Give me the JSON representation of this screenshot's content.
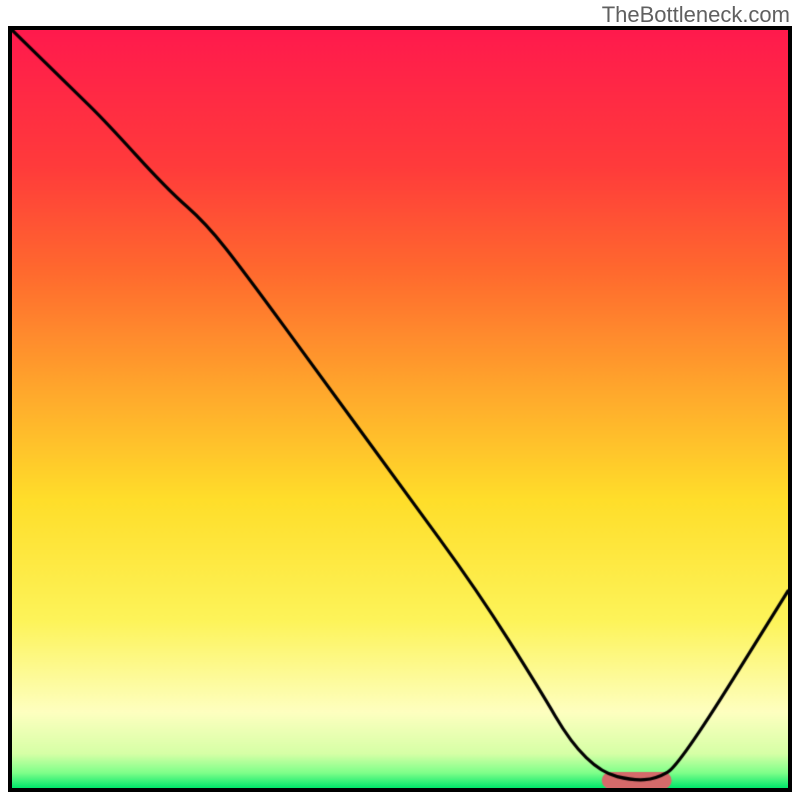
{
  "watermark": "TheBottleneck.com",
  "chart_data": {
    "type": "line",
    "title": "",
    "xlabel": "",
    "ylabel": "",
    "xlim": [
      0,
      100
    ],
    "ylim": [
      0,
      100
    ],
    "grid": false,
    "legend": false,
    "background_gradient": [
      {
        "t": 0.0,
        "color": "#ff1a4d"
      },
      {
        "t": 0.18,
        "color": "#ff3b3b"
      },
      {
        "t": 0.32,
        "color": "#ff6a2e"
      },
      {
        "t": 0.5,
        "color": "#ffb12c"
      },
      {
        "t": 0.62,
        "color": "#ffde2a"
      },
      {
        "t": 0.78,
        "color": "#fdf45a"
      },
      {
        "t": 0.9,
        "color": "#feffc0"
      },
      {
        "t": 0.955,
        "color": "#d6ffa6"
      },
      {
        "t": 0.98,
        "color": "#7fff8a"
      },
      {
        "t": 1.0,
        "color": "#00e66a"
      }
    ],
    "series": [
      {
        "name": "bottleneck-curve",
        "stroke": "#000000",
        "x": [
          0,
          8,
          12,
          20,
          25,
          30,
          40,
          50,
          60,
          68,
          72,
          76,
          80,
          83,
          86,
          100
        ],
        "values": [
          100,
          92,
          88,
          79,
          74.5,
          68,
          54,
          40,
          26,
          13,
          6,
          2,
          1,
          1.2,
          3,
          26
        ]
      }
    ],
    "marker": {
      "name": "optimal-marker",
      "color": "#d56a6a",
      "x_start": 76,
      "x_end": 85,
      "y": 1,
      "height": 2.2
    }
  }
}
